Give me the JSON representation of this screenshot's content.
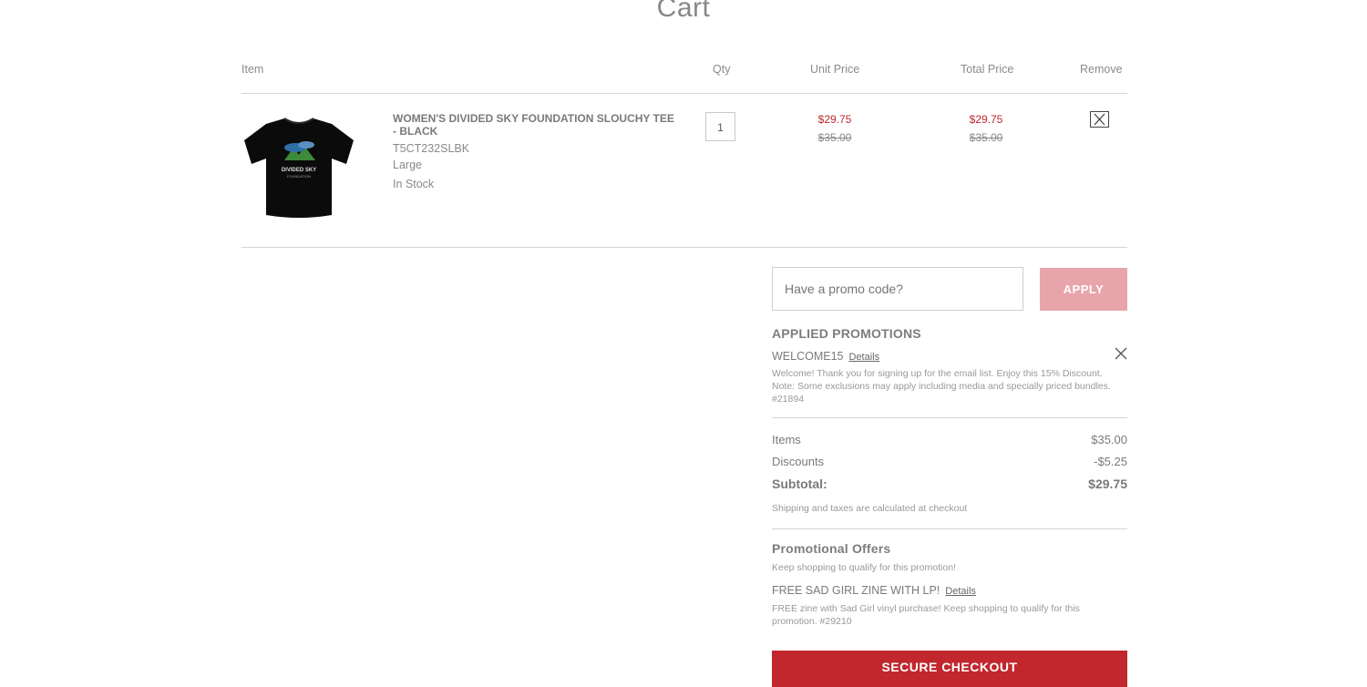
{
  "page": {
    "title": "Cart"
  },
  "table_headers": {
    "item": "Item",
    "qty": "Qty",
    "unit_price": "Unit Price",
    "total_price": "Total Price",
    "remove": "Remove"
  },
  "cart_item": {
    "name": "WOMEN'S DIVIDED SKY FOUNDATION SLOUCHY TEE - BLACK",
    "sku": "T5CT232SLBK",
    "size": "Large",
    "stock_status": "In Stock",
    "quantity": "1",
    "unit_price_sale": "$29.75",
    "unit_price_original": "$35.00",
    "total_price_sale": "$29.75",
    "total_price_original": "$35.00",
    "image_logo_text": "DIVIDED SKY",
    "image_logo_subtext": "FOUNDATION"
  },
  "promo": {
    "placeholder": "Have a promo code?",
    "apply_label": "APPLY"
  },
  "applied_promotions": {
    "heading": "APPLIED PROMOTIONS",
    "code": "WELCOME15",
    "details_label": "Details",
    "description": "Welcome! Thank you for signing up for the email list. Enjoy this 15% Discount. Note: Some exclusions may apply including media and specially priced bundles. #21894"
  },
  "summary": {
    "items_label": "Items",
    "items_value": "$35.00",
    "discounts_label": "Discounts",
    "discounts_value": "-$5.25",
    "subtotal_label": "Subtotal:",
    "subtotal_value": "$29.75",
    "note": "Shipping and taxes are calculated at checkout"
  },
  "promotional_offers": {
    "heading": "Promotional Offers",
    "intro": "Keep shopping to qualify for this promotion!",
    "offer_title": "FREE SAD GIRL ZINE WITH LP!",
    "details_label": "Details",
    "offer_description": "FREE zine with Sad Girl vinyl purchase! Keep shopping to qualify for this promotion. #29210"
  },
  "checkout": {
    "label": "SECURE CHECKOUT"
  },
  "colors": {
    "sale_red": "#c0272d",
    "apply_pink": "#e8a4ab",
    "checkout_red": "#c1272d"
  }
}
